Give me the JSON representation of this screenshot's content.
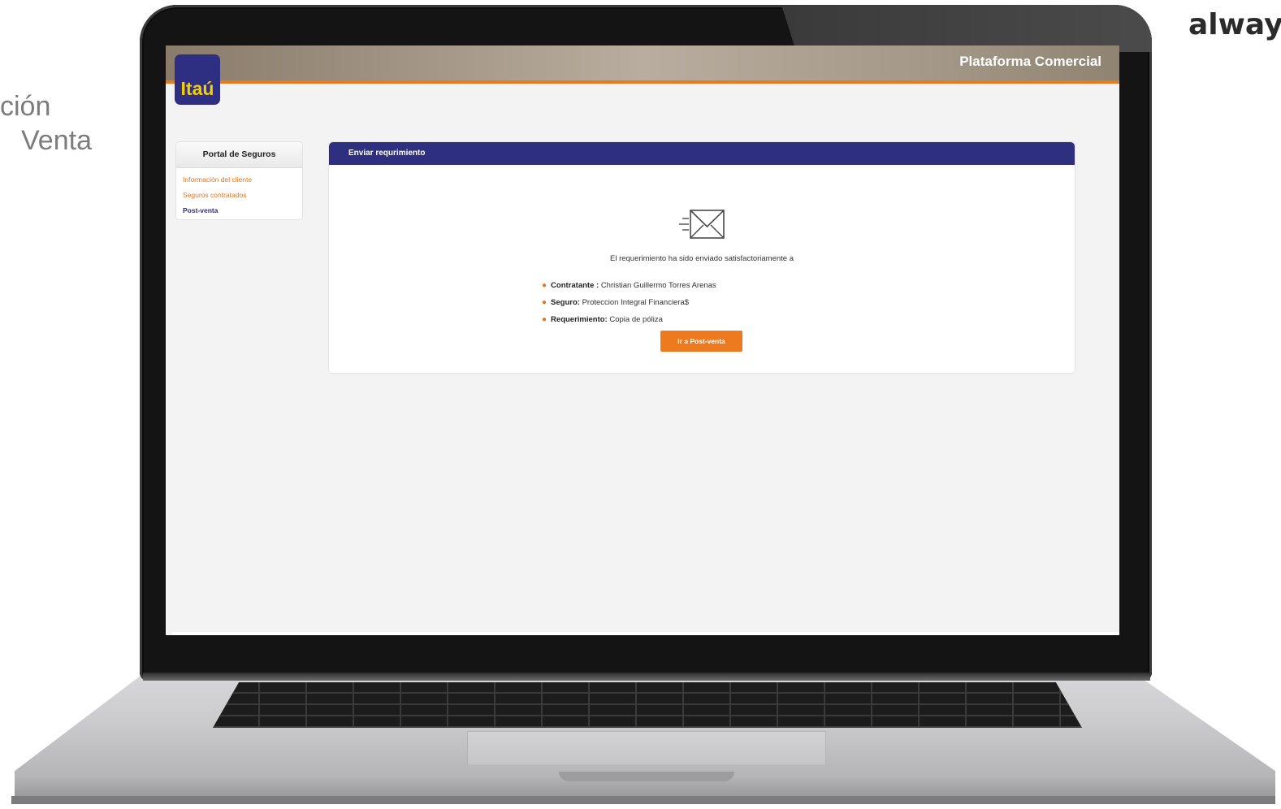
{
  "slide": {
    "left_text_line1": "ción",
    "left_text_line2": "Venta",
    "brand_word": "alway"
  },
  "app": {
    "logo_text": "Itaú",
    "platform_title": "Plataforma Comercial"
  },
  "sidebar": {
    "title": "Portal de Seguros",
    "items": [
      {
        "label": "Información del cliente",
        "active": false
      },
      {
        "label": "Seguros contratados",
        "active": false
      },
      {
        "label": "Post-venta",
        "active": true
      }
    ]
  },
  "panel": {
    "header": "Enviar requrimiento",
    "icon": "envelope-sent-icon",
    "message": "El requerimiento ha sido enviado satisfactoriamente a",
    "details": [
      {
        "label": "Contratante :",
        "value": "Christian Guillermo Torres Arenas"
      },
      {
        "label": "Seguro:",
        "value": "Proteccion Integral Financiera$"
      },
      {
        "label": "Requerimiento:",
        "value": "Copia de póliza"
      }
    ],
    "button_label": "Ir a Post-venta"
  },
  "colors": {
    "brand_blue": "#2e2f82",
    "brand_orange": "#ec7a1c",
    "logo_yellow": "#f5d000"
  }
}
